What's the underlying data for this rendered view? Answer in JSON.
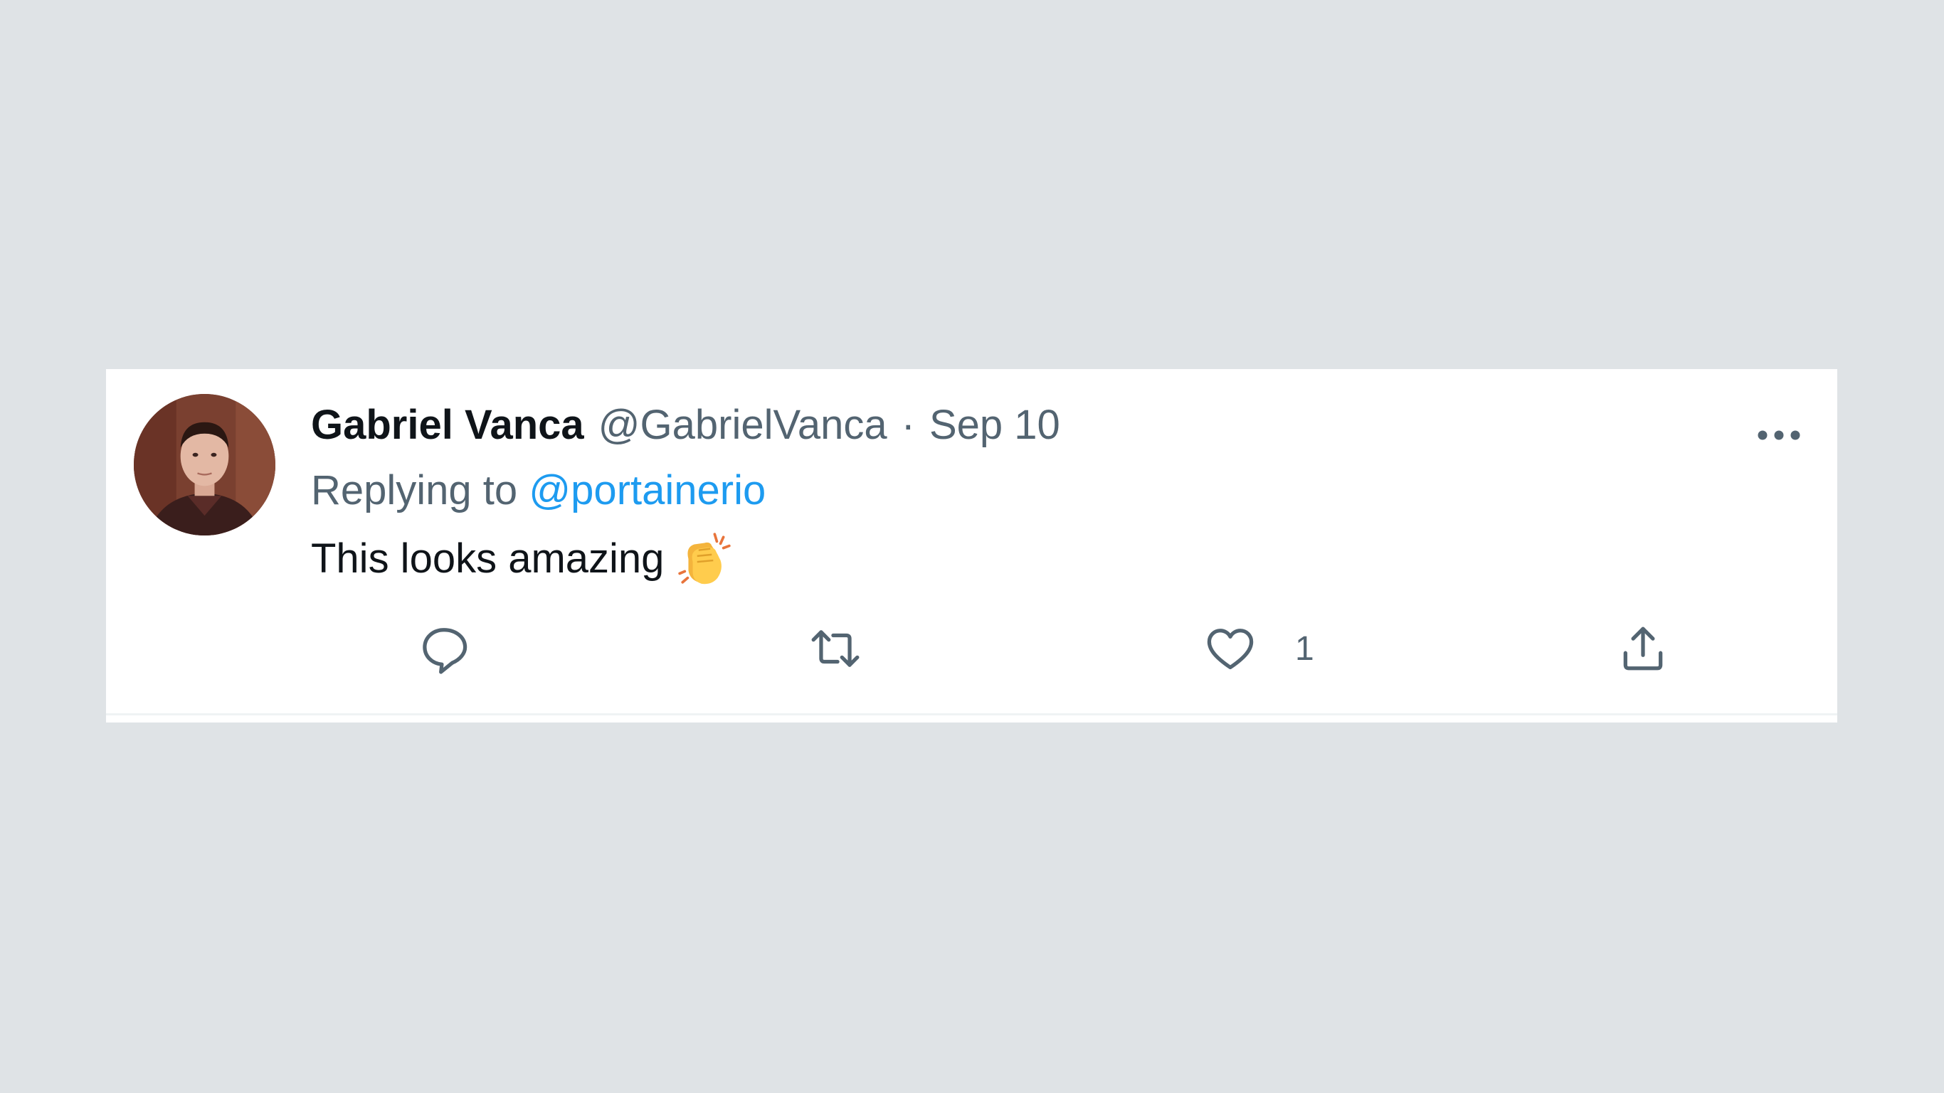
{
  "tweet": {
    "author": {
      "display_name": "Gabriel Vanca",
      "handle": "@GabrielVanca"
    },
    "separator": "·",
    "date": "Sep 10",
    "replying_to": {
      "prefix": "Replying to",
      "mention": "@portainerio"
    },
    "text": "This looks amazing",
    "emoji": "clapping-hands",
    "actions": {
      "reply_icon": "reply-icon",
      "retweet_icon": "retweet-icon",
      "like_icon": "heart-icon",
      "like_count": "1",
      "share_icon": "share-icon"
    },
    "more_icon": "more-options-icon"
  },
  "colors": {
    "background": "#dfe3e6",
    "card": "#ffffff",
    "primary_text": "#0f1419",
    "secondary_text": "#536471",
    "link": "#1d9bf0"
  }
}
